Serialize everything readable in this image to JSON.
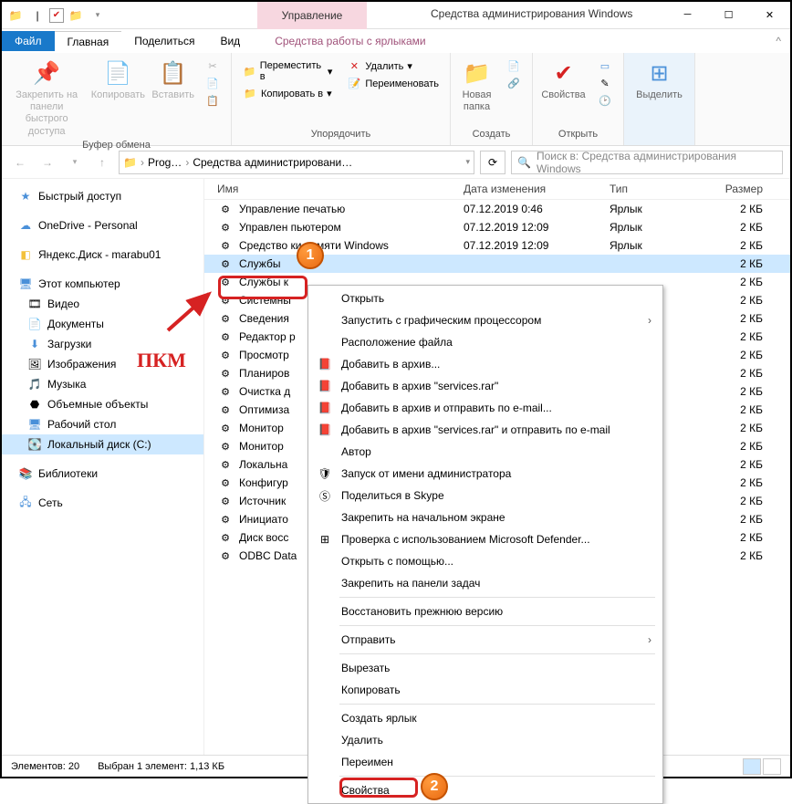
{
  "title": "Средства администрирования Windows",
  "manage_tab": "Управление",
  "tabs": {
    "file": "Файл",
    "home": "Главная",
    "share": "Поделиться",
    "view": "Вид",
    "shortcut": "Средства работы с ярлыками"
  },
  "ribbon": {
    "clipboard": {
      "pin": "Закрепить на панели быстрого доступа",
      "copy": "Копировать",
      "paste": "Вставить",
      "label": "Буфер обмена"
    },
    "organize": {
      "moveto": "Переместить в",
      "copyto": "Копировать в",
      "del": "Удалить",
      "rename": "Переименовать",
      "label": "Упорядочить"
    },
    "new": {
      "newfolder": "Новая папка",
      "label": "Создать"
    },
    "open": {
      "props": "Свойства",
      "label": "Открыть"
    },
    "select": {
      "select": "Выделить",
      "label": ""
    }
  },
  "breadcrumb": {
    "p1": "Prog…",
    "p2": "Средства администрировани…"
  },
  "search_placeholder": "Поиск в: Средства администрирования Windows",
  "sidebar": {
    "quick": "Быстрый доступ",
    "onedrive": "OneDrive - Personal",
    "yandex": "Яндекс.Диск - marabu01",
    "thispc": "Этот компьютер",
    "video": "Видео",
    "docs": "Документы",
    "downloads": "Загрузки",
    "pictures": "Изображения",
    "music": "Музыка",
    "objects3d": "Объемные объекты",
    "desktop": "Рабочий стол",
    "cdrive": "Локальный диск (C:)",
    "libraries": "Библиотеки",
    "network": "Сеть"
  },
  "headers": {
    "name": "Имя",
    "date": "Дата изменения",
    "type": "Тип",
    "size": "Размер"
  },
  "files": [
    {
      "name": "Управление печатью",
      "date": "07.12.2019 0:46",
      "type": "Ярлык",
      "size": "2 КБ"
    },
    {
      "name": "Управлен            пьютером",
      "date": "07.12.2019 12:09",
      "type": "Ярлык",
      "size": "2 КБ"
    },
    {
      "name": "Средство            ки памяти Windows",
      "date": "07.12.2019 12:09",
      "type": "Ярлык",
      "size": "2 КБ"
    },
    {
      "name": "Службы",
      "date": "",
      "type": "",
      "size": "2 КБ",
      "sel": true
    },
    {
      "name": "Службы к",
      "date": "",
      "type": "",
      "size": "2 КБ"
    },
    {
      "name": "Системны",
      "date": "",
      "type": "",
      "size": "2 КБ"
    },
    {
      "name": "Сведения",
      "date": "",
      "type": "",
      "size": "2 КБ"
    },
    {
      "name": "Редактор р",
      "date": "",
      "type": "",
      "size": "2 КБ"
    },
    {
      "name": "Просмотр",
      "date": "",
      "type": "",
      "size": "2 КБ"
    },
    {
      "name": "Планиров",
      "date": "",
      "type": "",
      "size": "2 КБ"
    },
    {
      "name": "Очистка д",
      "date": "",
      "type": "",
      "size": "2 КБ"
    },
    {
      "name": "Оптимиза",
      "date": "",
      "type": "",
      "size": "2 КБ"
    },
    {
      "name": "Монитор",
      "date": "",
      "type": "",
      "size": "2 КБ"
    },
    {
      "name": "Монитор",
      "date": "",
      "type": "",
      "size": "2 КБ"
    },
    {
      "name": "Локальна",
      "date": "",
      "type": "",
      "size": "2 КБ"
    },
    {
      "name": "Конфигур",
      "date": "",
      "type": "",
      "size": "2 КБ"
    },
    {
      "name": "Источник",
      "date": "",
      "type": "",
      "size": "2 КБ"
    },
    {
      "name": "Инициато",
      "date": "",
      "type": "",
      "size": "2 КБ"
    },
    {
      "name": "Диск восс",
      "date": "",
      "type": "",
      "size": "2 КБ"
    },
    {
      "name": "ODBC Data",
      "date": "",
      "type": "",
      "size": "2 КБ"
    }
  ],
  "context_menu": [
    {
      "type": "item",
      "text": "Открыть"
    },
    {
      "type": "item",
      "text": "Запустить с графическим процессором",
      "arrow": true
    },
    {
      "type": "item",
      "text": "Расположение файла"
    },
    {
      "type": "item",
      "text": "Добавить в архив...",
      "icon": "rar"
    },
    {
      "type": "item",
      "text": "Добавить в архив \"services.rar\"",
      "icon": "rar"
    },
    {
      "type": "item",
      "text": "Добавить в архив и отправить по e-mail...",
      "icon": "rar"
    },
    {
      "type": "item",
      "text": "Добавить в архив \"services.rar\" и отправить по e-mail",
      "icon": "rar"
    },
    {
      "type": "item",
      "text": "Автор"
    },
    {
      "type": "item",
      "text": "Запуск от имени администратора",
      "icon": "shield"
    },
    {
      "type": "item",
      "text": "Поделиться в Skype",
      "icon": "skype"
    },
    {
      "type": "item",
      "text": "Закрепить на начальном экране"
    },
    {
      "type": "item",
      "text": "Проверка с использованием Microsoft Defender...",
      "icon": "defender"
    },
    {
      "type": "item",
      "text": "Открыть с помощью..."
    },
    {
      "type": "item",
      "text": "Закрепить на панели задач"
    },
    {
      "type": "sep"
    },
    {
      "type": "item",
      "text": "Восстановить прежнюю версию"
    },
    {
      "type": "sep"
    },
    {
      "type": "item",
      "text": "Отправить",
      "arrow": true
    },
    {
      "type": "sep"
    },
    {
      "type": "item",
      "text": "Вырезать"
    },
    {
      "type": "item",
      "text": "Копировать"
    },
    {
      "type": "sep"
    },
    {
      "type": "item",
      "text": "Создать ярлык"
    },
    {
      "type": "item",
      "text": "Удалить"
    },
    {
      "type": "item",
      "text": "Переимен"
    },
    {
      "type": "sep"
    },
    {
      "type": "item",
      "text": "Свойства"
    }
  ],
  "status": {
    "count": "Элементов: 20",
    "selected": "Выбран 1 элемент: 1,13 КБ"
  },
  "pkm_label": "ПКМ",
  "badge1": "1",
  "badge2": "2"
}
